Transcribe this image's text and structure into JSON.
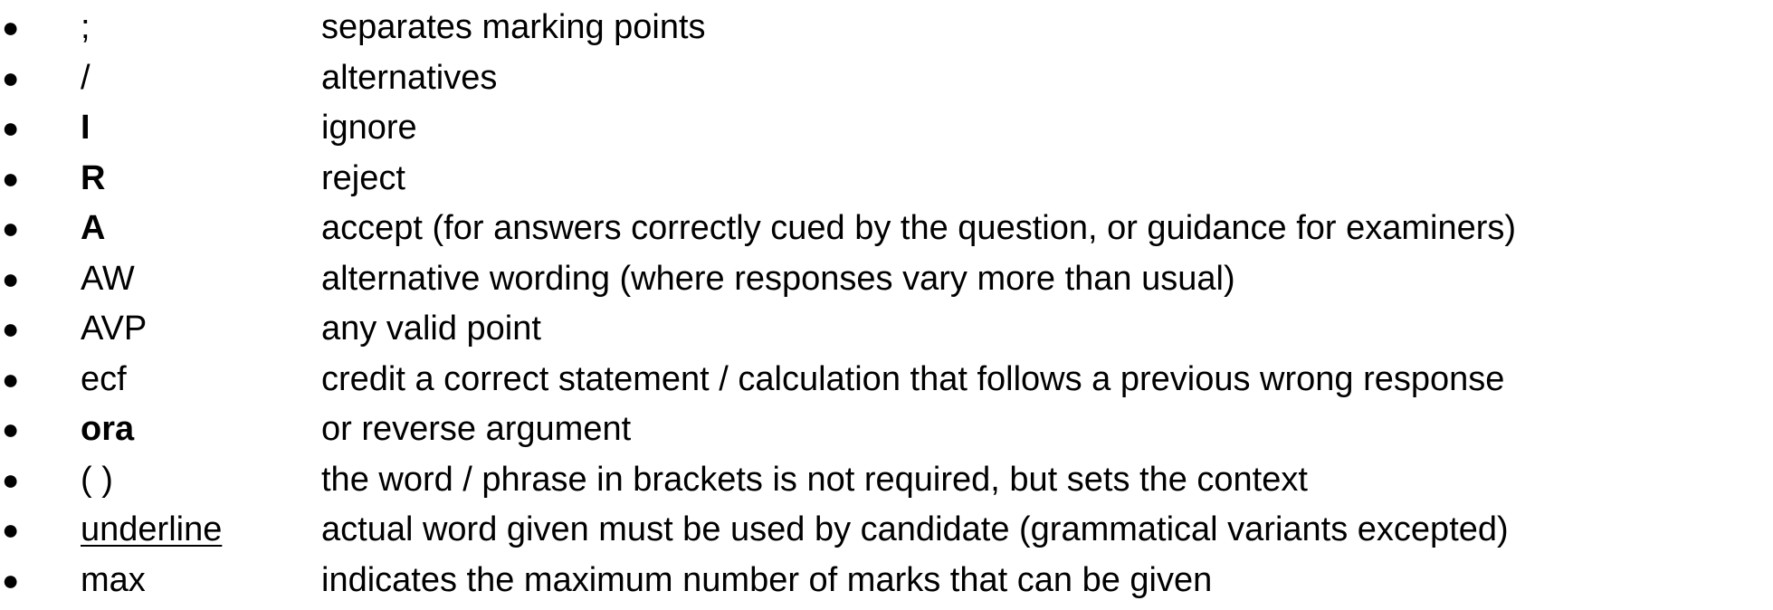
{
  "marking_key": {
    "items": [
      {
        "symbol": ";",
        "style": "normal",
        "meaning": "separates marking points"
      },
      {
        "symbol": "/",
        "style": "normal",
        "meaning": "alternatives"
      },
      {
        "symbol": "I",
        "style": "bold",
        "meaning": "ignore"
      },
      {
        "symbol": "R",
        "style": "bold",
        "meaning": "reject"
      },
      {
        "symbol": "A",
        "style": "bold",
        "meaning": "accept (for answers correctly cued by the question, or guidance for examiners)"
      },
      {
        "symbol": "AW",
        "style": "normal",
        "meaning": "alternative wording (where responses vary more than usual)"
      },
      {
        "symbol": "AVP",
        "style": "normal",
        "meaning": "any valid point"
      },
      {
        "symbol": "ecf",
        "style": "normal",
        "meaning": "credit a correct statement / calculation that follows a previous wrong response"
      },
      {
        "symbol": "ora",
        "style": "bold",
        "meaning": "or reverse argument"
      },
      {
        "symbol": "( )",
        "style": "normal",
        "meaning": "the word / phrase in brackets is not required, but sets the context"
      },
      {
        "symbol": "underline",
        "style": "underline",
        "meaning": "actual word given must be used by candidate (grammatical variants excepted)"
      },
      {
        "symbol": "max",
        "style": "normal",
        "meaning": "indicates the maximum number of marks that can be given"
      }
    ]
  }
}
